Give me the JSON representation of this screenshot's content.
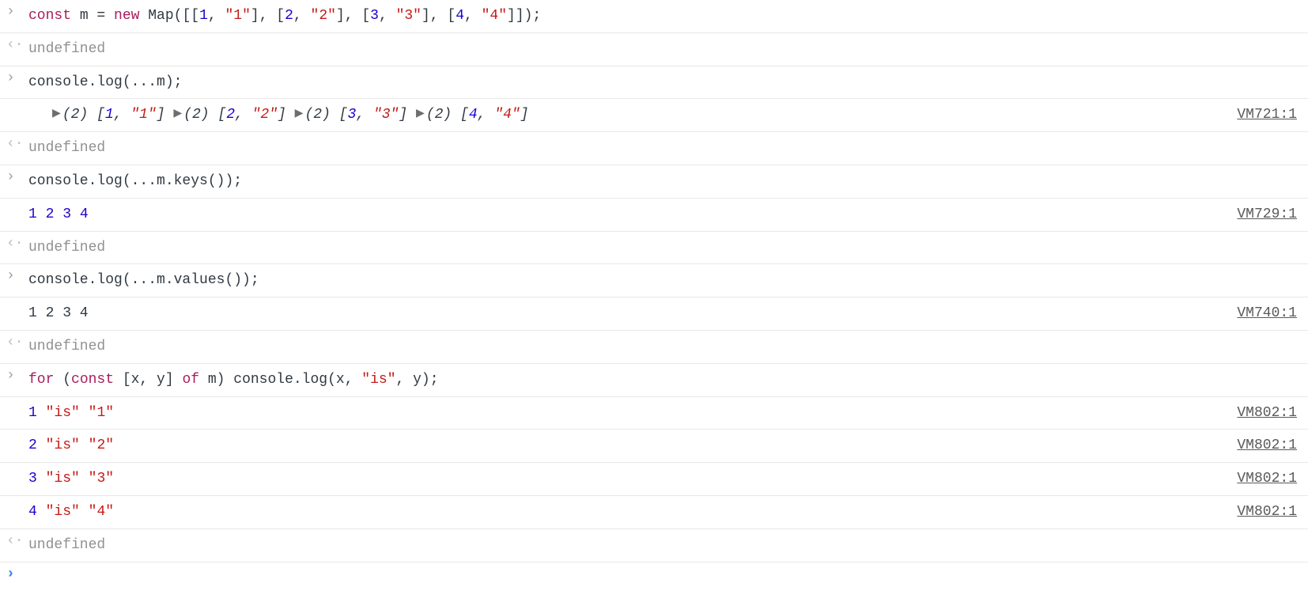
{
  "glyphs": {
    "input": "›",
    "return": "‹·",
    "tri": "▶"
  },
  "rows": [
    {
      "kind": "input",
      "code": [
        {
          "t": "kw",
          "v": "const"
        },
        {
          "t": "p",
          "v": " m = "
        },
        {
          "t": "kw",
          "v": "new"
        },
        {
          "t": "p",
          "v": " Map([["
        },
        {
          "t": "num",
          "v": "1"
        },
        {
          "t": "p",
          "v": ", "
        },
        {
          "t": "str",
          "v": "\"1\""
        },
        {
          "t": "p",
          "v": "], ["
        },
        {
          "t": "num",
          "v": "2"
        },
        {
          "t": "p",
          "v": ", "
        },
        {
          "t": "str",
          "v": "\"2\""
        },
        {
          "t": "p",
          "v": "], ["
        },
        {
          "t": "num",
          "v": "3"
        },
        {
          "t": "p",
          "v": ", "
        },
        {
          "t": "str",
          "v": "\"3\""
        },
        {
          "t": "p",
          "v": "], ["
        },
        {
          "t": "num",
          "v": "4"
        },
        {
          "t": "p",
          "v": ", "
        },
        {
          "t": "str",
          "v": "\"4\""
        },
        {
          "t": "p",
          "v": "]]);"
        }
      ]
    },
    {
      "kind": "return",
      "undef": "undefined"
    },
    {
      "kind": "input",
      "code": [
        {
          "t": "p",
          "v": "console.log(...m);"
        }
      ]
    },
    {
      "kind": "log",
      "src": "VM721:1",
      "entries": [
        {
          "count": "(2)",
          "open": "[",
          "k": "1",
          "v": "\"1\"",
          "close": "]"
        },
        {
          "count": "(2)",
          "open": "[",
          "k": "2",
          "v": "\"2\"",
          "close": "]"
        },
        {
          "count": "(2)",
          "open": "[",
          "k": "3",
          "v": "\"3\"",
          "close": "]"
        },
        {
          "count": "(2)",
          "open": "[",
          "k": "4",
          "v": "\"4\"",
          "close": "]"
        }
      ]
    },
    {
      "kind": "return",
      "undef": "undefined"
    },
    {
      "kind": "input",
      "code": [
        {
          "t": "p",
          "v": "console.log(...m.keys());"
        }
      ]
    },
    {
      "kind": "log-nums",
      "src": "VM729:1",
      "nums": [
        "1",
        "2",
        "3",
        "4"
      ]
    },
    {
      "kind": "return",
      "undef": "undefined"
    },
    {
      "kind": "input",
      "code": [
        {
          "t": "p",
          "v": "console.log(...m.values());"
        }
      ]
    },
    {
      "kind": "log-plain",
      "src": "VM740:1",
      "text": "1 2 3 4"
    },
    {
      "kind": "return",
      "undef": "undefined"
    },
    {
      "kind": "input",
      "code": [
        {
          "t": "kw",
          "v": "for"
        },
        {
          "t": "p",
          "v": " ("
        },
        {
          "t": "kw",
          "v": "const"
        },
        {
          "t": "p",
          "v": " [x, y] "
        },
        {
          "t": "kw",
          "v": "of"
        },
        {
          "t": "p",
          "v": " m) console.log(x, "
        },
        {
          "t": "str",
          "v": "\"is\""
        },
        {
          "t": "p",
          "v": ", y);"
        }
      ]
    },
    {
      "kind": "log-isline",
      "src": "VM802:1",
      "n": "1",
      "is": "\"is\"",
      "s": "\"1\""
    },
    {
      "kind": "log-isline",
      "src": "VM802:1",
      "n": "2",
      "is": "\"is\"",
      "s": "\"2\""
    },
    {
      "kind": "log-isline",
      "src": "VM802:1",
      "n": "3",
      "is": "\"is\"",
      "s": "\"3\""
    },
    {
      "kind": "log-isline",
      "src": "VM802:1",
      "n": "4",
      "is": "\"is\"",
      "s": "\"4\""
    },
    {
      "kind": "return",
      "undef": "undefined"
    },
    {
      "kind": "prompt"
    }
  ]
}
